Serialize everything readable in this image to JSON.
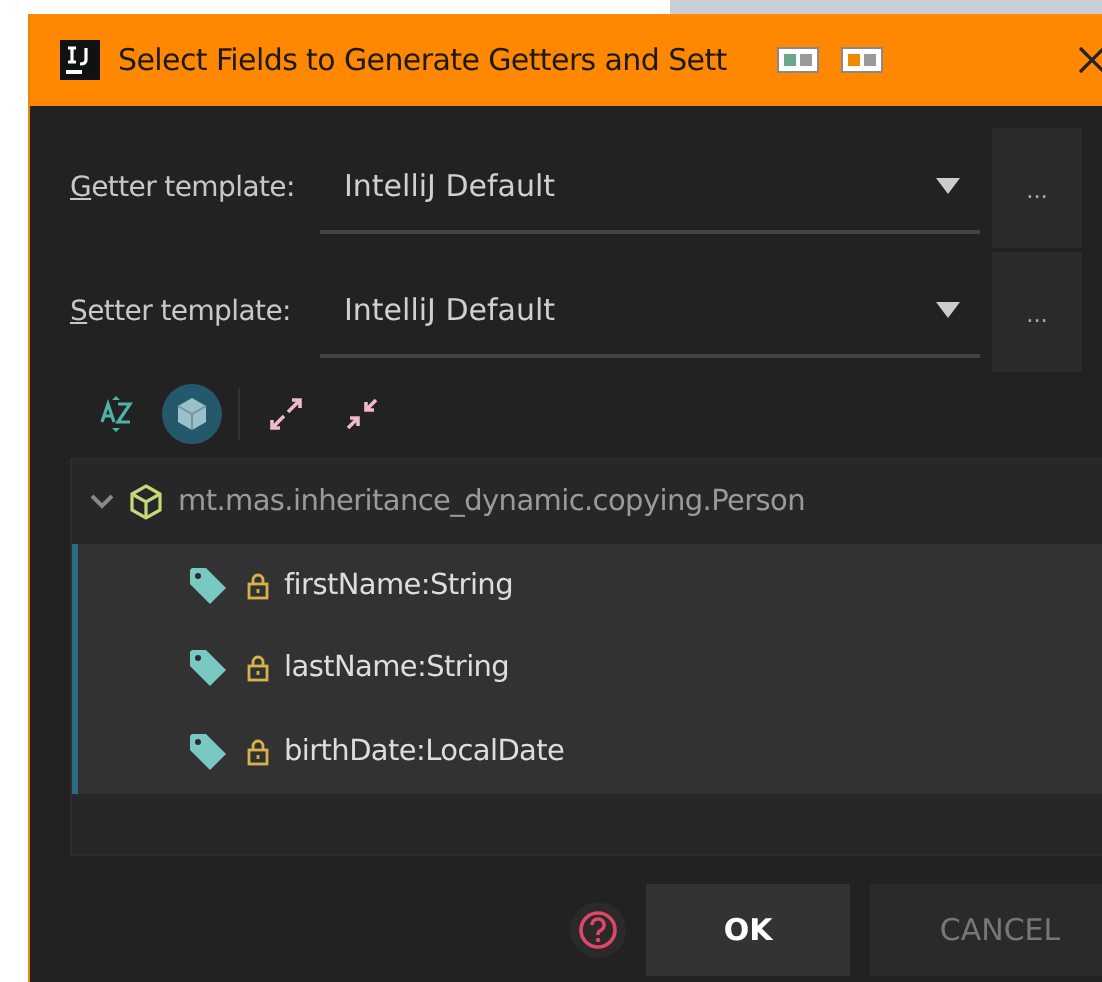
{
  "window": {
    "title": "Select Fields to Generate Getters and Sett"
  },
  "templates": [
    {
      "label": "Getter template:",
      "value": "IntelliJ Default",
      "more": "..."
    },
    {
      "label": "Setter template:",
      "value": "IntelliJ Default",
      "more": "..."
    }
  ],
  "toolbar": [
    {
      "kind": "sort",
      "selected": false
    },
    {
      "kind": "classes",
      "selected": true
    },
    {
      "kind": "expand",
      "selected": false
    },
    {
      "kind": "collapse",
      "selected": false
    }
  ],
  "tree": {
    "label": "mt.mas.inheritance_dynamic.copying.Person",
    "expanded": true,
    "children": [
      {
        "label": "firstName:String",
        "selected": true
      },
      {
        "label": "lastName:String",
        "selected": true
      },
      {
        "label": "birthDate:LocalDate",
        "selected": true
      }
    ]
  },
  "buttons": [
    {
      "label": "OK",
      "disabled": false
    },
    {
      "label": "CANCEL",
      "disabled": true
    }
  ]
}
